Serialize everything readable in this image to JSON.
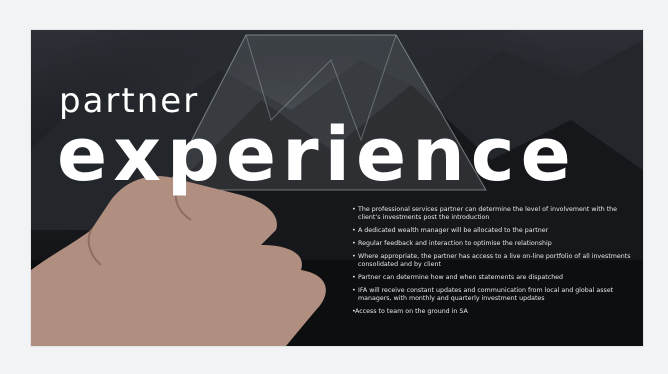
{
  "slide": {
    "title_small": "partner",
    "title_large": "experience",
    "bullets": [
      "The professional services partner can determine the level of involvement with the client’s investments post the introduction",
      "A dedicated wealth manager will be allocated to the partner",
      "Regular feedback and interaction to optimise the relationship",
      "Where appropriate, the partner has access to a live on-line portfolio of all investments consolidated and by client",
      "Partner can determine how and when statements are dispatched",
      "IFA will receive constant updates and communication from local and global asset managers, with monthly and quarterly investment updates",
      "Access to team on the ground in SA"
    ],
    "bullet_marker": "•"
  },
  "colors": {
    "background": "#0e0f11",
    "text": "#ffffff",
    "page": "#f2f3f5"
  }
}
